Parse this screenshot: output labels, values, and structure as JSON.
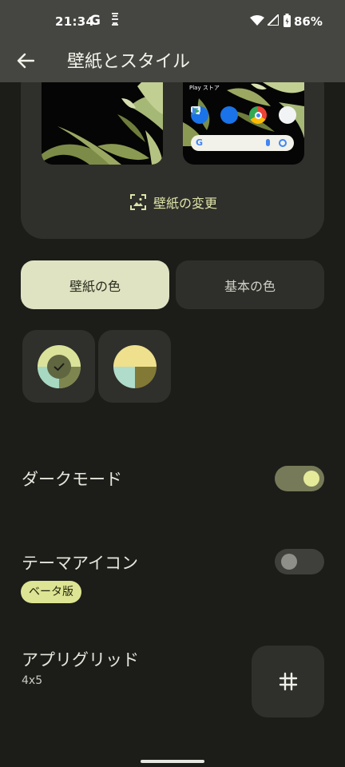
{
  "status_bar": {
    "time": "21:34",
    "notification_g": "G",
    "battery_percent": "86%"
  },
  "app_bar": {
    "title": "壁紙とスタイル",
    "back_icon": "arrow-back-icon"
  },
  "preview": {
    "home_store_label": "Play ストア",
    "search_g": "G",
    "change_wallpaper_label": "壁紙の変更",
    "change_wallpaper_icon": "image-frame-icon"
  },
  "color_tabs": {
    "wallpaper_colors": "壁紙の色",
    "basic_colors": "基本の色",
    "selected": "wallpaper_colors"
  },
  "swatches": [
    {
      "colors": [
        "#dbe39b",
        "#7f854f",
        "#a7d8c1",
        "#5f6640"
      ],
      "selected": true
    },
    {
      "colors": [
        "#efe08d",
        "#827936",
        "#b0dccb"
      ],
      "selected": false
    }
  ],
  "settings": {
    "dark_mode": {
      "label": "ダークモード",
      "enabled": true
    },
    "themed_icons": {
      "label": "テーマアイコン",
      "badge": "ベータ版",
      "enabled": false
    },
    "app_grid": {
      "label": "アプリグリッド",
      "value": "4x5",
      "icon": "grid-hash-icon"
    }
  },
  "colors": {
    "accent": "#dfe3a8",
    "background": "#1c1d19",
    "app_bar": "#454641"
  }
}
